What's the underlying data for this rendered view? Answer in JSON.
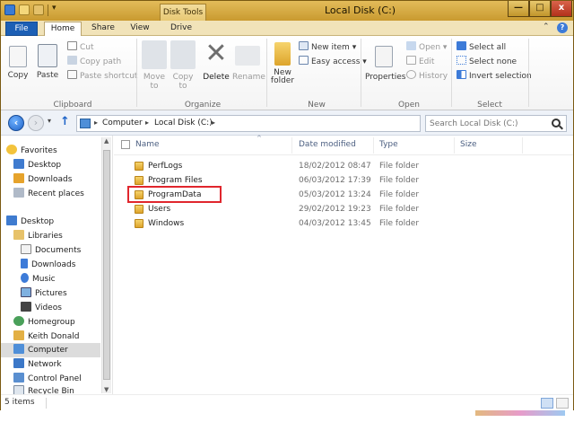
{
  "window": {
    "title": "Local Disk (C:)",
    "contextual_tab": "Disk Tools",
    "min_symbol": "—",
    "max_symbol": "□",
    "close_symbol": "x"
  },
  "tabs": [
    {
      "label": "File"
    },
    {
      "label": "Home"
    },
    {
      "label": "Share"
    },
    {
      "label": "View"
    },
    {
      "label": "Drive"
    }
  ],
  "ribbon": {
    "clipboard": {
      "copy": "Copy",
      "paste": "Paste",
      "cut": "Cut",
      "copy_path": "Copy path",
      "paste_shortcut": "Paste shortcut",
      "group": "Clipboard"
    },
    "organize": {
      "move_to": "Move to",
      "copy_to": "Copy to",
      "delete": "Delete",
      "rename": "Rename",
      "group": "Organize"
    },
    "new": {
      "new_folder": "New folder",
      "new_item": "New item",
      "easy_access": "Easy access",
      "group": "New"
    },
    "open": {
      "properties": "Properties",
      "open": "Open",
      "edit": "Edit",
      "history": "History",
      "group": "Open"
    },
    "select": {
      "select_all": "Select all",
      "select_none": "Select none",
      "invert_selection": "Invert selection",
      "group": "Select"
    }
  },
  "address": {
    "crumbs": [
      "Computer",
      "Local Disk (C:)"
    ],
    "search_placeholder": "Search Local Disk (C:)"
  },
  "navigation": {
    "items": [
      {
        "label": "Favorites"
      },
      {
        "label": "Desktop"
      },
      {
        "label": "Downloads"
      },
      {
        "label": "Recent places"
      },
      {
        "label": "Desktop"
      },
      {
        "label": "Libraries"
      },
      {
        "label": "Documents"
      },
      {
        "label": "Downloads"
      },
      {
        "label": "Music"
      },
      {
        "label": "Pictures"
      },
      {
        "label": "Videos"
      },
      {
        "label": "Homegroup"
      },
      {
        "label": "Keith Donald"
      },
      {
        "label": "Computer"
      },
      {
        "label": "Network"
      },
      {
        "label": "Control Panel"
      },
      {
        "label": "Recycle Bin"
      }
    ]
  },
  "columns": {
    "name": "Name",
    "date_modified": "Date modified",
    "type": "Type",
    "size": "Size"
  },
  "files": [
    {
      "name": "PerfLogs",
      "date": "18/02/2012 08:47",
      "type": "File folder"
    },
    {
      "name": "Program Files",
      "date": "06/03/2012 17:39",
      "type": "File folder"
    },
    {
      "name": "ProgramData",
      "date": "05/03/2012 13:24",
      "type": "File folder"
    },
    {
      "name": "Users",
      "date": "29/02/2012 19:23",
      "type": "File folder"
    },
    {
      "name": "Windows",
      "date": "04/03/2012 13:45",
      "type": "File folder"
    }
  ],
  "status": {
    "item_count": "5 items"
  },
  "colors": {
    "accent": "#1c5fb5",
    "title_bar": "#c99a2f",
    "highlight_box": "#e0262d",
    "folder": "#dda42b"
  }
}
